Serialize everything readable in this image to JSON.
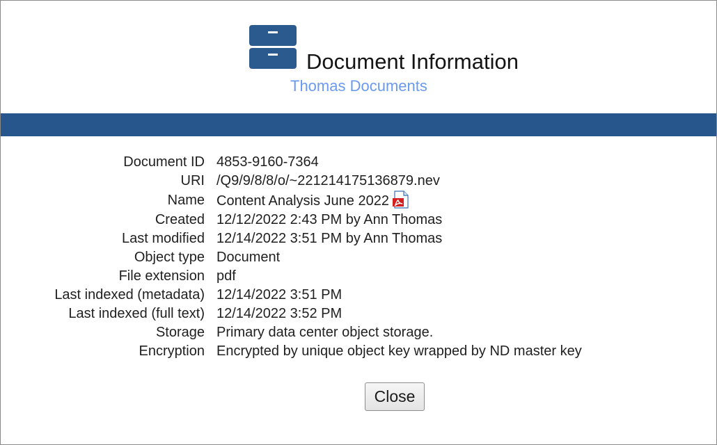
{
  "header": {
    "title": "Document Information",
    "subtitle": "Thomas Documents",
    "icon": "file-cabinet-icon",
    "icon_color": "#2b5a8f"
  },
  "colors": {
    "accent_band": "#27568d",
    "subtitle_link": "#6a9af0"
  },
  "details": [
    {
      "label": "Document ID",
      "value": "4853-9160-7364"
    },
    {
      "label": "URI",
      "value": "/Q9/9/8/8/o/~221214175136879.nev"
    },
    {
      "label": "Name",
      "value": "Content Analysis June 2022",
      "icon": "pdf-icon"
    },
    {
      "label": "Created",
      "value": "12/12/2022 2:43 PM by Ann Thomas"
    },
    {
      "label": "Last modified",
      "value": "12/14/2022 3:51 PM by Ann Thomas"
    },
    {
      "label": "Object type",
      "value": "Document"
    },
    {
      "label": "File extension",
      "value": "pdf"
    },
    {
      "label": "Last indexed (metadata)",
      "value": "12/14/2022 3:51 PM"
    },
    {
      "label": "Last indexed (full text)",
      "value": "12/14/2022 3:52 PM"
    },
    {
      "label": "Storage",
      "value": "Primary data center object storage."
    },
    {
      "label": "Encryption",
      "value": "Encrypted by unique object key wrapped by ND master key"
    }
  ],
  "actions": {
    "close_label": "Close"
  }
}
